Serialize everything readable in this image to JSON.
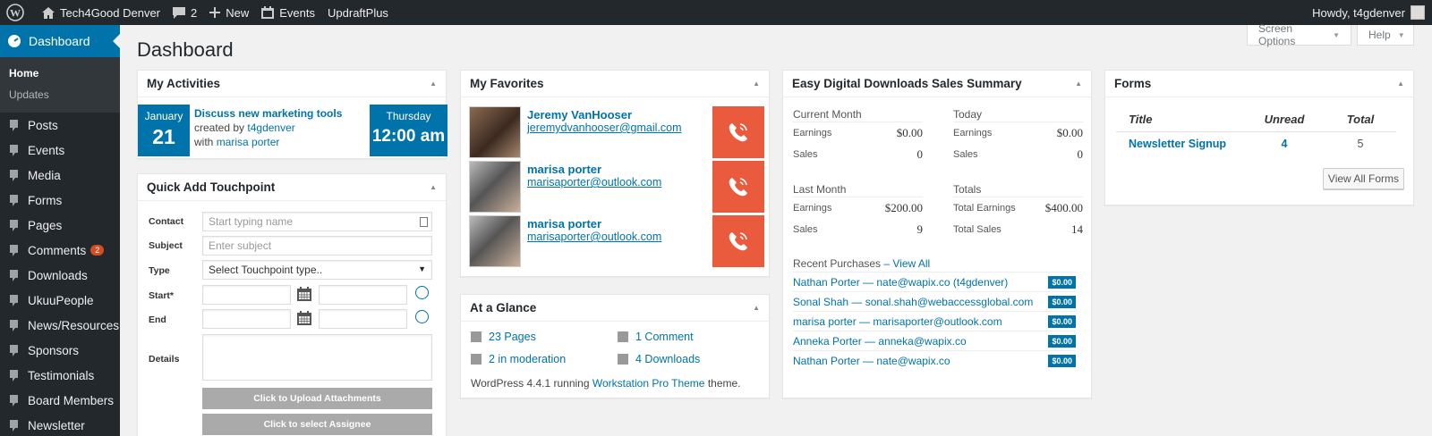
{
  "admin_bar": {
    "site_name": "Tech4Good Denver",
    "comments_count": "2",
    "new_label": "New",
    "events_label": "Events",
    "updraft_label": "UpdraftPlus",
    "howdy": "Howdy, t4gdenver"
  },
  "sidebar": {
    "dashboard": "Dashboard",
    "submenu": [
      "Home",
      "Updates"
    ],
    "items": [
      {
        "label": "Posts",
        "icon": "pin-icon"
      },
      {
        "label": "Events",
        "icon": "calendar-icon"
      },
      {
        "label": "Media",
        "icon": "media-icon"
      },
      {
        "label": "Forms",
        "icon": "forms-icon"
      },
      {
        "label": "Pages",
        "icon": "pages-icon"
      },
      {
        "label": "Comments",
        "icon": "comment-icon",
        "badge": "2"
      },
      {
        "label": "Downloads",
        "icon": "download-icon"
      },
      {
        "label": "UkuuPeople",
        "icon": "ukuu-icon"
      },
      {
        "label": "News/Resources",
        "icon": "pin-icon"
      },
      {
        "label": "Sponsors",
        "icon": "pin-icon"
      },
      {
        "label": "Testimonials",
        "icon": "pin-icon"
      },
      {
        "label": "Board Members",
        "icon": "pin-icon"
      },
      {
        "label": "Newsletter",
        "icon": "pin-icon"
      }
    ]
  },
  "header": {
    "title": "Dashboard",
    "screen_options": "Screen Options",
    "help": "Help"
  },
  "activities": {
    "title": "My Activities",
    "month": "January",
    "day": "21",
    "activity_link": "Discuss new marketing tools",
    "created_by_prefix": "created by",
    "created_by": "t4gdenver",
    "with_prefix": "with",
    "with_person": "marisa porter",
    "weekday": "Thursday",
    "time": "12:00 am"
  },
  "quick_add": {
    "title": "Quick Add Touchpoint",
    "contact_label": "Contact",
    "contact_placeholder": "Start typing name",
    "subject_label": "Subject",
    "subject_placeholder": "Enter subject",
    "type_label": "Type",
    "type_value": "Select Touchpoint type..",
    "start_label": "Start*",
    "end_label": "End",
    "details_label": "Details",
    "upload_button": "Click to Upload Attachments",
    "assignee_button": "Click to select Assignee"
  },
  "favorites": {
    "title": "My Favorites",
    "people": [
      {
        "name": "Jeremy VanHooser",
        "email": "jeremydvanhooser@gmail.com"
      },
      {
        "name": "marisa porter",
        "email": "marisaporter@outlook.com"
      },
      {
        "name": "marisa porter",
        "email": "marisaporter@outlook.com"
      }
    ]
  },
  "edd": {
    "title": "Easy Digital Downloads Sales Summary",
    "current_month": {
      "header": "Current Month",
      "earnings_label": "Earnings",
      "earnings": "$0.00",
      "sales_label": "Sales",
      "sales": "0"
    },
    "today": {
      "header": "Today",
      "earnings_label": "Earnings",
      "earnings": "$0.00",
      "sales_label": "Sales",
      "sales": "0"
    },
    "last_month": {
      "header": "Last Month",
      "earnings_label": "Earnings",
      "earnings": "$200.00",
      "sales_label": "Sales",
      "sales": "9"
    },
    "totals": {
      "header": "Totals",
      "earnings_label": "Total Earnings",
      "earnings": "$400.00",
      "sales_label": "Total Sales",
      "sales": "14"
    },
    "recent_label": "Recent Purchases",
    "view_all": "– View All",
    "purchases": [
      {
        "text": "Nathan Porter — nate@wapix.co (t4gdenver)",
        "amount": "$0.00"
      },
      {
        "text": "Sonal Shah — sonal.shah@webaccessglobal.com",
        "amount": "$0.00"
      },
      {
        "text": "marisa porter — marisaporter@outlook.com",
        "amount": "$0.00"
      },
      {
        "text": "Anneka Porter — anneka@wapix.co",
        "amount": "$0.00"
      },
      {
        "text": "Nathan Porter — nate@wapix.co",
        "amount": "$0.00"
      }
    ]
  },
  "glance": {
    "title": "At a Glance",
    "pages": "23 Pages",
    "comments": "1 Comment",
    "moderation": "2 in moderation",
    "downloads": "4 Downloads",
    "footer_prefix": "WordPress 4.4.1 running",
    "theme": "Workstation Pro Theme",
    "footer_suffix": "theme."
  },
  "forms": {
    "title": "Forms",
    "col_title": "Title",
    "col_unread": "Unread",
    "col_total": "Total",
    "rows": [
      {
        "title": "Newsletter Signup",
        "unread": "4",
        "total": "5"
      }
    ],
    "view_all": "View All Forms"
  },
  "colors": {
    "accent": "#0073aa",
    "call": "#ea5a3c",
    "bar": "#23282d"
  }
}
